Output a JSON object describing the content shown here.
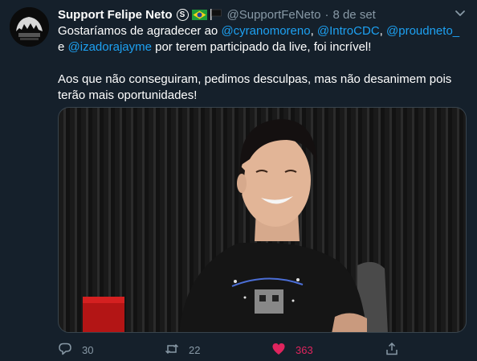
{
  "tweet": {
    "display_name": "Support Felipe Neto",
    "handle": "@SupportFeNeto",
    "separator": "·",
    "date": "8 de set",
    "badge_letter": "S",
    "text": {
      "p1_a": "Gostaríamos de agradecer ao ",
      "mention1": "@cyranomoreno",
      "sep1": ", ",
      "mention2": "@IntroCDC",
      "sep2": ", ",
      "mention3": "@proudneto_",
      "p1_b": " e ",
      "mention4": "@izadorajayme",
      "p1_c": " por terem participado da live, foi incrível!",
      "p2": "Aos que não conseguiram, pedimos desculpas, mas não desanimem pois terão mais oportunidades!"
    },
    "actions": {
      "reply_count": "30",
      "retweet_count": "22",
      "like_count": "363"
    }
  },
  "colors": {
    "background": "#15202b",
    "accent": "#1da1f2",
    "muted": "#8899a6",
    "like": "#e0245e"
  },
  "icons": {
    "reply": "reply-icon",
    "retweet": "retweet-icon",
    "like": "heart-icon",
    "share": "share-icon",
    "menu": "chevron-down-icon"
  }
}
